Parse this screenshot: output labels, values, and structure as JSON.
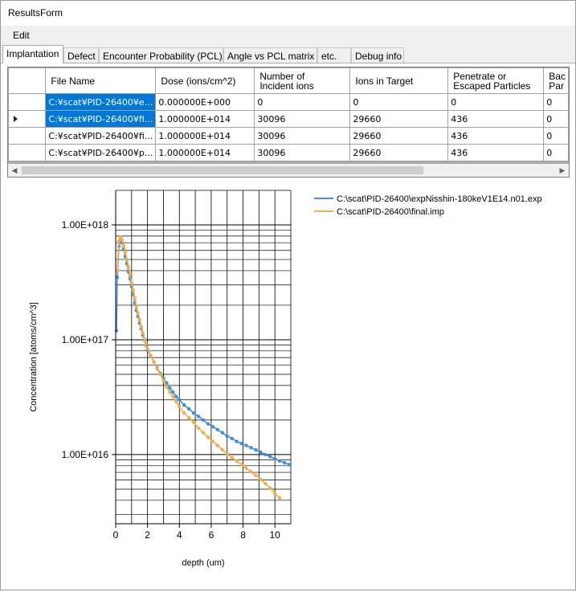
{
  "window": {
    "title": "ResultsForm"
  },
  "menu": {
    "edit_label": "Edit"
  },
  "tabs": [
    {
      "label": "Implantation"
    },
    {
      "label": "Defect"
    },
    {
      "label": "Encounter Probability (PCL)"
    },
    {
      "label": "Angle vs PCL matrix"
    },
    {
      "label": "etc."
    },
    {
      "label": "Debug info"
    }
  ],
  "grid": {
    "headers": [
      "File Name",
      "Dose (ions/cm^2)",
      "Number of\nIncident ions",
      "Ions in Target",
      "Penetrate or\nEscaped Particles",
      "Bac\nPar"
    ],
    "rows": [
      [
        "C:¥scat¥PID-26400¥e...",
        "0.000000E+000",
        "0",
        "0",
        "0",
        "0"
      ],
      [
        "C:¥scat¥PID-26400¥fi...",
        "1.000000E+014",
        "30096",
        "29660",
        "436",
        "0"
      ],
      [
        "C:¥scat¥PID-26400¥fi...",
        "1.000000E+014",
        "30096",
        "29660",
        "436",
        "0"
      ],
      [
        "C:¥scat¥PID-26400¥p...",
        "1.000000E+014",
        "30096",
        "29660",
        "436",
        "0"
      ]
    ]
  },
  "chart_data": {
    "type": "scatter",
    "xlabel": "depth (um)",
    "ylabel": "Concentration [atoms/cm^3]",
    "y_scale": "log",
    "xlim": [
      0,
      11
    ],
    "ylim": [
      2500000000000000.0,
      2e+18
    ],
    "x_ticks": [
      "0",
      "2",
      "4",
      "6",
      "8",
      "10"
    ],
    "y_ticks": [
      "1.00E+016",
      "1.00E+017",
      "1.00E+018"
    ],
    "grid": true,
    "legend_position": "top-right",
    "series": [
      {
        "name": "C:\\scat\\PID-26400\\expNisshin-180keV1E14.n01.exp",
        "color": "#3f8fe0",
        "x": [
          0.05,
          0.1,
          0.2,
          0.3,
          0.4,
          0.5,
          0.6,
          0.7,
          0.8,
          0.9,
          1.0,
          1.1,
          1.2,
          1.3,
          1.4,
          1.5,
          1.6,
          1.7,
          1.8,
          1.9,
          2.0,
          2.2,
          2.4,
          2.6,
          2.8,
          3.0,
          3.2,
          3.4,
          3.6,
          3.8,
          4.0,
          4.3,
          4.6,
          4.9,
          5.2,
          5.5,
          5.8,
          6.1,
          6.4,
          6.7,
          7.0,
          7.3,
          7.6,
          7.9,
          8.2,
          8.5,
          8.8,
          9.1,
          9.4,
          9.7,
          10.0,
          10.3,
          10.6,
          10.9
        ],
        "y": [
          1.2e+17,
          3.5e+17,
          6.5e+17,
          7.5e+17,
          7e+17,
          6.2e+17,
          5.3e+17,
          4.6e+17,
          3.9e+17,
          3.4e+17,
          2.9e+17,
          2.5e+17,
          2.1e+17,
          1.8e+17,
          1.6e+17,
          1.4e+17,
          1.25e+17,
          1.1e+17,
          1e+17,
          9e+16,
          8.2e+16,
          7.2e+16,
          6.4e+16,
          5.7e+16,
          5.1e+16,
          4.6e+16,
          4.2e+16,
          3.8e+16,
          3.5e+16,
          3.2e+16,
          3e+16,
          2.7e+16,
          2.5e+16,
          2.3e+16,
          2.15e+16,
          2e+16,
          1.85e+16,
          1.75e+16,
          1.65e+16,
          1.55e+16,
          1.45e+16,
          1.38e+16,
          1.3e+16,
          1.25e+16,
          1.2e+16,
          1.15e+16,
          1.1e+16,
          1.05e+16,
          1e+16,
          9600000000000000.0,
          9200000000000000.0,
          8800000000000000.0,
          8500000000000000.0,
          8200000000000000.0
        ]
      },
      {
        "name": "C:\\scat\\PID-26400\\final.imp",
        "color": "#f5ad48",
        "x": [
          0.1,
          0.2,
          0.3,
          0.4,
          0.5,
          0.6,
          0.7,
          0.8,
          0.9,
          1.0,
          1.1,
          1.2,
          1.3,
          1.4,
          1.5,
          1.6,
          1.7,
          1.8,
          1.9,
          2.0,
          2.2,
          2.4,
          2.6,
          2.8,
          3.0,
          3.2,
          3.4,
          3.6,
          3.8,
          4.0,
          4.3,
          4.6,
          4.9,
          5.2,
          5.5,
          5.8,
          6.1,
          6.4,
          6.7,
          7.0,
          7.3,
          7.6,
          7.9,
          8.2,
          8.5,
          8.8,
          9.1,
          9.4,
          9.7,
          10.0,
          10.3
        ],
        "y": [
          4e+17,
          7.2e+17,
          7.8e+17,
          7.4e+17,
          6.6e+17,
          5.8e+17,
          5e+17,
          4.3e+17,
          3.7e+17,
          3.1e+17,
          2.7e+17,
          2.3e+17,
          1.95e+17,
          1.7e+17,
          1.5e+17,
          1.3e+17,
          1.15e+17,
          1.02e+17,
          9.2e+16,
          8.4e+16,
          7.3e+16,
          6.4e+16,
          5.6e+16,
          5e+16,
          4.4e+16,
          3.9e+16,
          3.5e+16,
          3.2e+16,
          2.9e+16,
          2.6e+16,
          2.3e+16,
          2.1e+16,
          1.9e+16,
          1.7e+16,
          1.55e+16,
          1.42e+16,
          1.3e+16,
          1.2e+16,
          1.1e+16,
          1.02e+16,
          9400000000000000.0,
          8800000000000000.0,
          8200000000000000.0,
          7600000000000000.0,
          7100000000000000.0,
          6600000000000000.0,
          6100000000000000.0,
          5600000000000000.0,
          5100000000000000.0,
          4600000000000000.0,
          4200000000000000.0
        ]
      }
    ]
  }
}
